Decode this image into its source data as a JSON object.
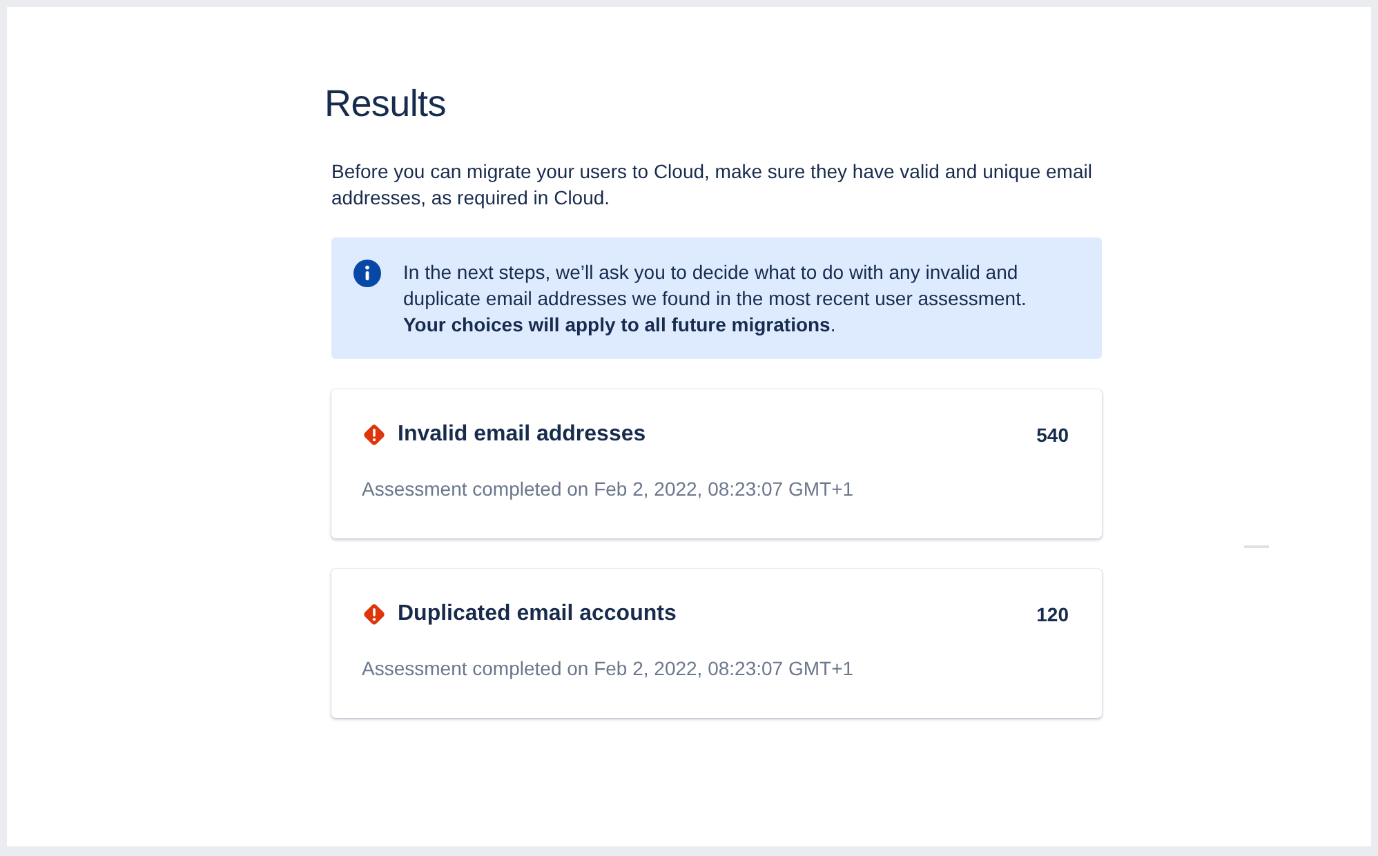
{
  "title": "Results",
  "intro": "Before you can migrate your users to Cloud, make sure they have valid and unique email addresses, as required in Cloud.",
  "info": {
    "text": "In the next steps, we’ll ask you to decide what to do with any invalid and duplicate email addresses we found in the most recent user assessment.\n**Your choices will apply to all future migrations**."
  },
  "cards": [
    {
      "title": "Invalid email addresses",
      "count": "540",
      "status": "Assessment completed on Feb 2, 2022, 08:23:07 GMT+1"
    },
    {
      "title": "Duplicated email accounts",
      "count": "120",
      "status": "Assessment completed on Feb 2, 2022, 08:23:07 GMT+1"
    }
  ]
}
